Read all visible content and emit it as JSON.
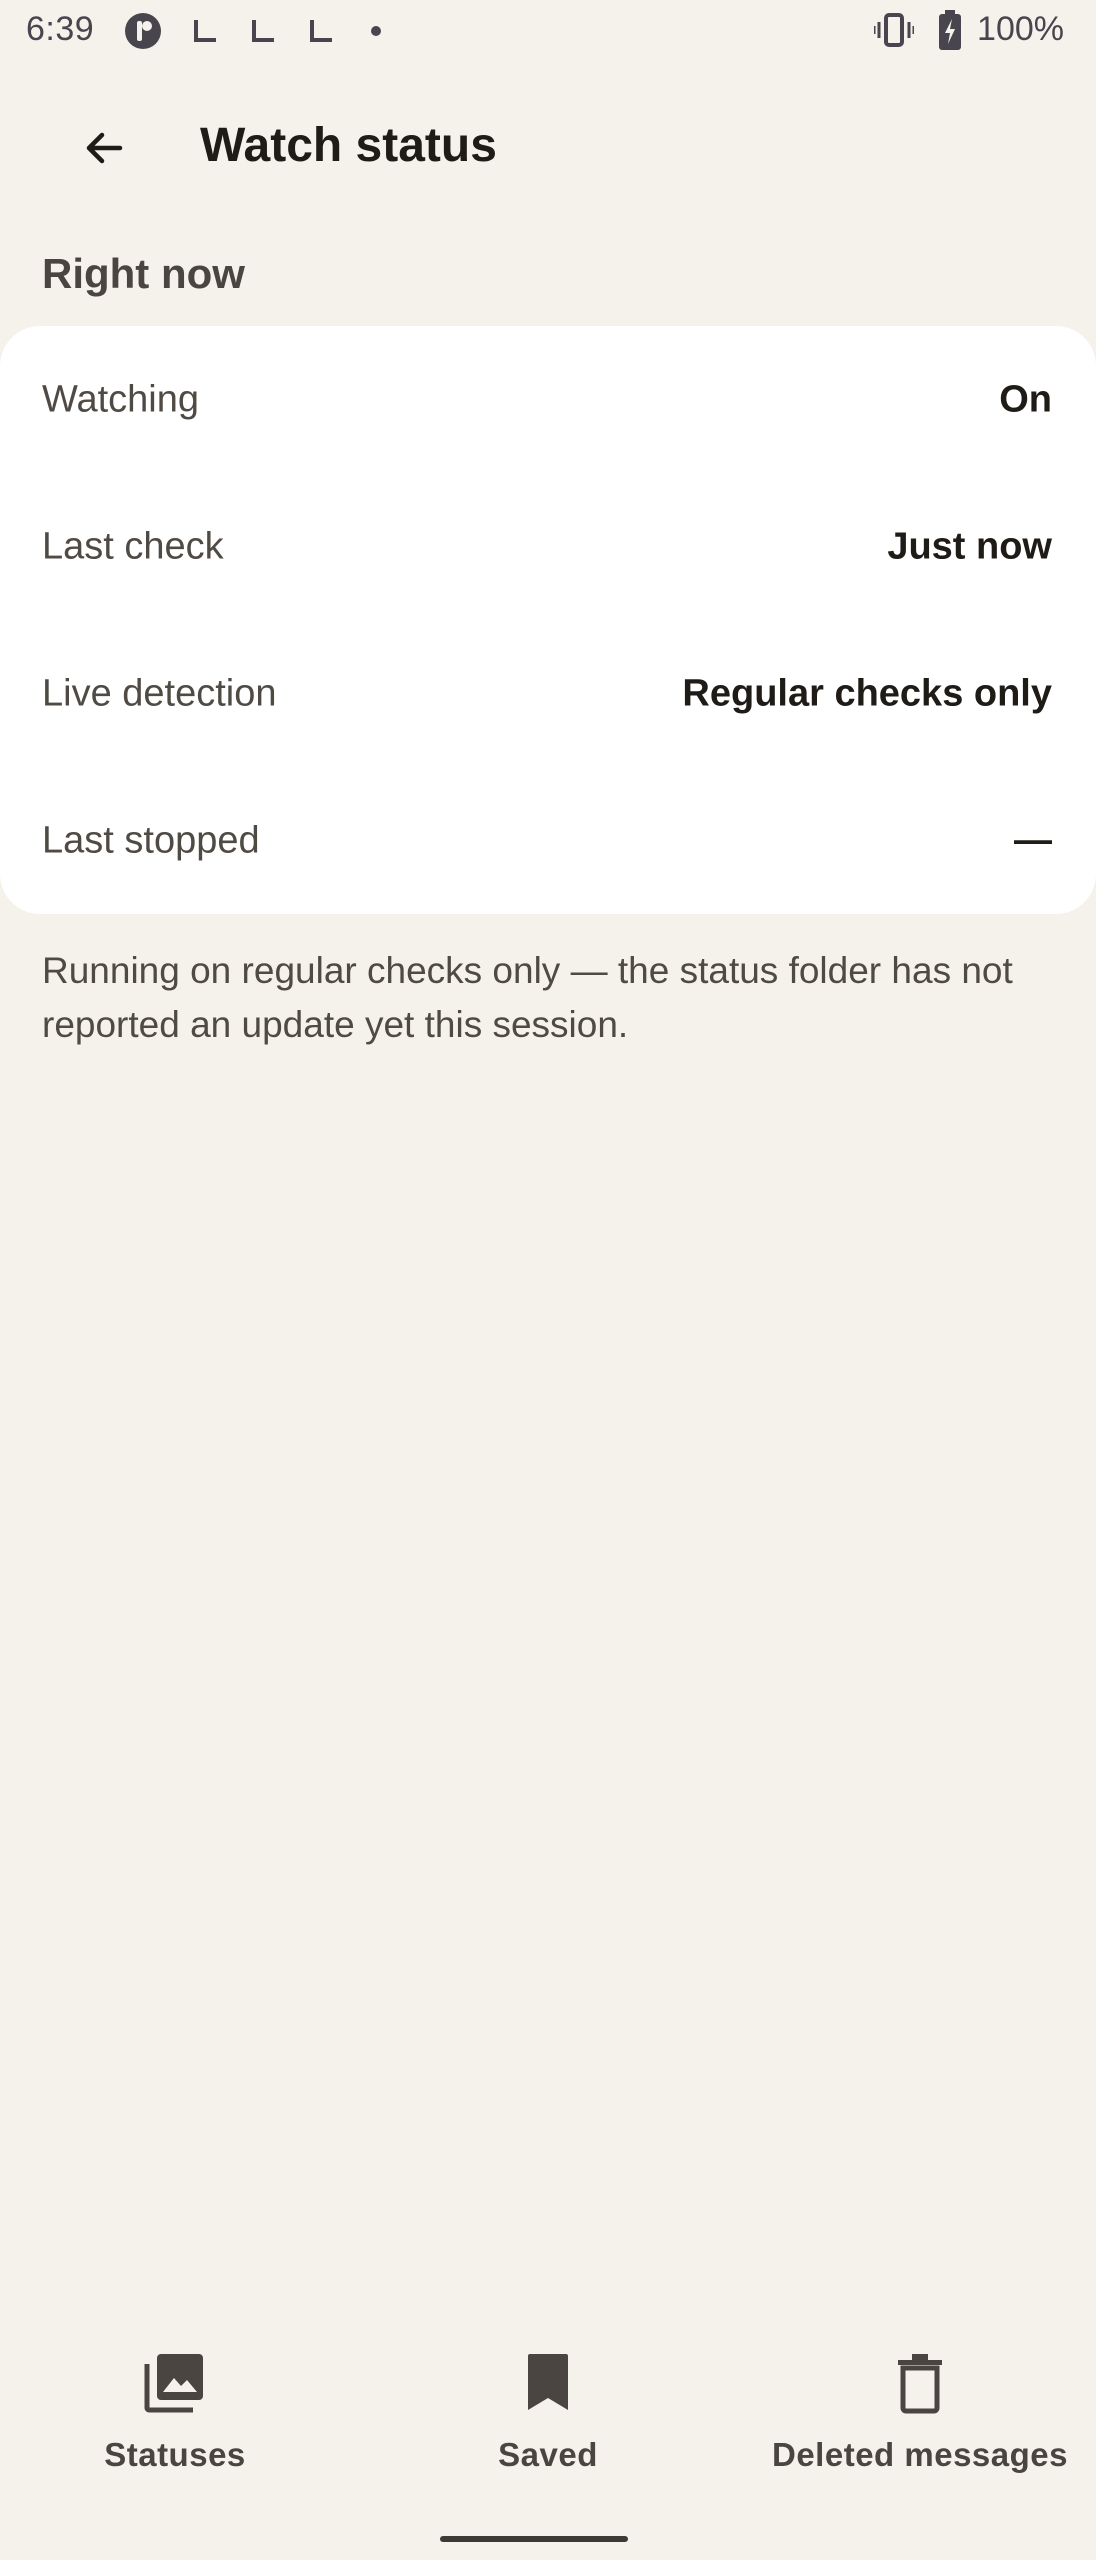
{
  "status_bar": {
    "time": "6:39",
    "battery": "100%",
    "icons": [
      "app-badge-icon",
      "l-shape-icon",
      "l-shape-icon",
      "l-shape-icon",
      "dot-icon",
      "vibrate-icon",
      "battery-charging-icon"
    ]
  },
  "app_bar": {
    "title": "Watch status",
    "back_icon": "arrow-back-icon"
  },
  "section": {
    "heading": "Right now"
  },
  "rows": [
    {
      "label": "Watching",
      "value": "On"
    },
    {
      "label": "Last check",
      "value": "Just now"
    },
    {
      "label": "Live detection",
      "value": "Regular checks only"
    },
    {
      "label": "Last stopped",
      "value": "—"
    }
  ],
  "description": "Running on regular checks only — the status folder has not reported an update yet this session.",
  "bottom_nav": {
    "items": [
      {
        "label": "Statuses",
        "icon": "photo-library-icon"
      },
      {
        "label": "Saved",
        "icon": "bookmark-icon"
      },
      {
        "label": "Deleted messages",
        "icon": "delete-icon"
      }
    ]
  },
  "colors": {
    "background": "#f5f1eb",
    "card": "#ffffff",
    "text_primary": "#1f1b16",
    "text_secondary": "#4f4a44"
  }
}
